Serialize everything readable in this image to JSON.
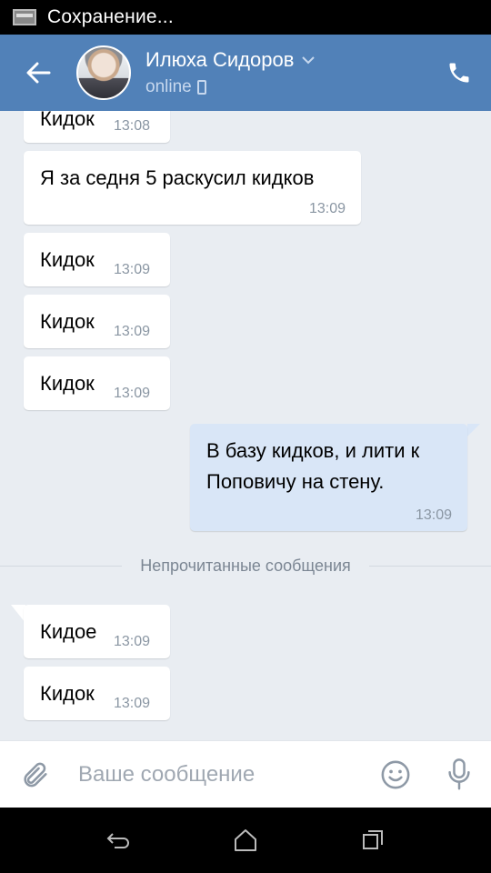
{
  "statusbar": {
    "text": "Сохранение..."
  },
  "header": {
    "contact_name": "Илюха Сидоров",
    "status": "online",
    "avatar_icon": "avatar-photo",
    "back_icon": "arrow-left-icon",
    "call_icon": "phone-icon"
  },
  "messages": [
    {
      "dir": "in",
      "text": "Кидок",
      "time": "13:08"
    },
    {
      "dir": "in",
      "text": "Я за седня 5 раскусил кидков",
      "time": "13:09"
    },
    {
      "dir": "in",
      "text": "Кидок",
      "time": "13:09"
    },
    {
      "dir": "in",
      "text": "Кидок",
      "time": "13:09"
    },
    {
      "dir": "in",
      "text": "Кидок",
      "time": "13:09"
    },
    {
      "dir": "out",
      "text": "В базу кидков, и лити к\nПоповичу на стену.",
      "time": "13:09"
    },
    {
      "dir": "in",
      "text": "Кидое",
      "time": "13:09"
    },
    {
      "dir": "in",
      "text": "Кидок",
      "time": "13:09"
    }
  ],
  "divider": {
    "text": "Непрочитанные сообщения"
  },
  "composer": {
    "placeholder": "Ваше сообщение"
  },
  "colors": {
    "header": "#5181b8",
    "bg": "#e9edf2",
    "out_bubble": "#d9e6f7"
  }
}
